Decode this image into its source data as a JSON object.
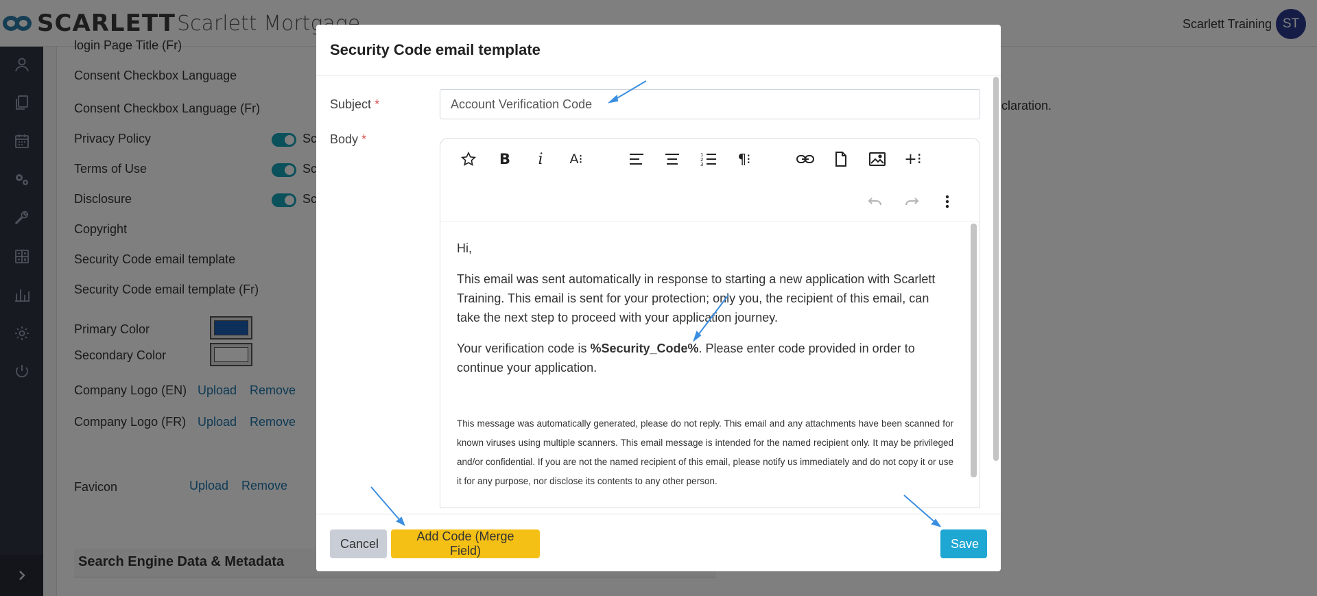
{
  "header": {
    "logo_text": "SCARLETT",
    "app_title": "Scarlett Mortgage",
    "user_name": "Scarlett Training",
    "user_initials": "ST"
  },
  "sidebar": {
    "icons": [
      "user-icon",
      "documents-icon",
      "calendar-icon",
      "settings-group-icon",
      "wrench-icon",
      "calculator-icon",
      "bar-chart-icon",
      "gear-icon",
      "power-icon"
    ],
    "expand_icon": "chevron-right-icon"
  },
  "background": {
    "fields": {
      "login_page_title_fr": "login Page Title (Fr)",
      "consent_checkbox": "Consent Checkbox Language",
      "consent_checkbox_fr": "Consent Checkbox Language (Fr)",
      "privacy_policy": "Privacy Policy",
      "terms_of_use": "Terms of Use",
      "disclosure": "Disclosure",
      "copyright": "Copyright",
      "security_code_template": "Security Code email template",
      "security_code_template_fr": "Security Code email template (Fr)",
      "primary_color": "Primary Color",
      "secondary_color": "Secondary Color",
      "company_logo_en": "Company Logo (EN)",
      "company_logo_fr": "Company Logo (FR)",
      "favicon": "Favicon"
    },
    "toggle_text": "Sc",
    "upload_label": "Upload",
    "remove_label": "Remove",
    "right_text": "éclaration.",
    "section_header": "Search Engine Data & Metadata",
    "colors": {
      "primary": "#1a5fb4",
      "secondary": "#ffffff"
    }
  },
  "modal": {
    "title": "Security Code email template",
    "subject_label": "Subject",
    "body_label": "Body",
    "required_mark": "*",
    "subject_value": "Account Verification Code",
    "toolbar": [
      "star-icon",
      "bold-icon",
      "italic-icon",
      "text-size-icon",
      "align-left-icon",
      "align-center-icon",
      "ordered-list-icon",
      "paragraph-icon",
      "link-icon",
      "file-icon",
      "image-icon",
      "insert-more-icon",
      "undo-icon",
      "redo-icon",
      "more-vertical-icon"
    ],
    "body": {
      "greeting": "Hi,",
      "paragraph1": "This email was sent automatically in response to starting a new application with Scarlett Training. This email is sent for your protection; only you, the recipient of this email, can take the next step to proceed with your application journey.",
      "paragraph2_prefix": "Your verification code is ",
      "merge_field": "%Security_Code%",
      "paragraph2_suffix": ". Please enter code provided in order to continue your application.",
      "disclaimer": "This message was automatically generated, please do not reply. This email and any attachments have been scanned for known viruses using multiple scanners. This email message is intended for the named recipient only. It may be privileged and/or confidential. If you are not the named recipient of this email, please notify us immediately and do not copy it or use it for any purpose, nor disclose its contents to any other person."
    },
    "buttons": {
      "cancel": "Cancel",
      "add_code": "Add Code (Merge Field)",
      "save": "Save"
    }
  },
  "accent_colors": {
    "toggle": "#17a2b8",
    "save": "#1ea7d3",
    "add_code": "#f5c016",
    "cancel": "#c9ced6",
    "annotation_arrow": "#3b8ee0"
  }
}
